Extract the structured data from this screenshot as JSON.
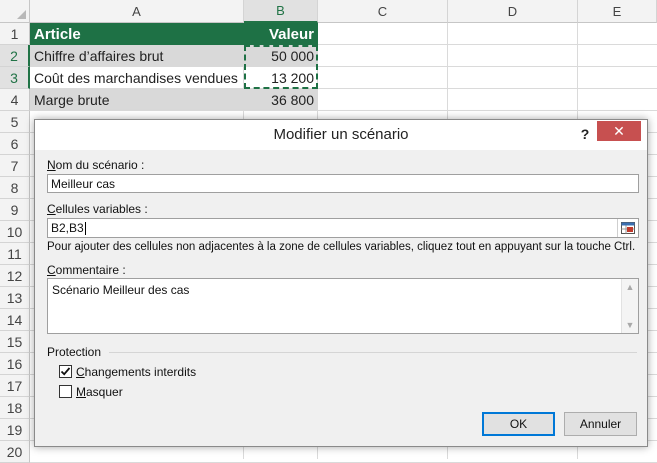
{
  "sheet": {
    "columns": [
      "A",
      "B",
      "C",
      "D",
      "E"
    ],
    "rows": [
      "1",
      "2",
      "3",
      "4",
      "5",
      "6",
      "7",
      "8",
      "9",
      "10",
      "11",
      "12",
      "13",
      "14",
      "15",
      "16",
      "17",
      "18",
      "19",
      "20"
    ],
    "table": {
      "header": {
        "article": "Article",
        "valeur": "Valeur"
      },
      "rows": [
        {
          "article": "Chiffre d’affaires brut",
          "valeur": "50 000"
        },
        {
          "article": "Coût des marchandises vendues",
          "valeur": "13 200"
        },
        {
          "article": "Marge brute",
          "valeur": "36 800"
        }
      ]
    },
    "colors": {
      "header_fill": "#1e7145",
      "gray_fill": "#d9d9d9",
      "selection": "#217346"
    }
  },
  "dialog": {
    "title": "Modifier un scénario",
    "help": "?",
    "close": "✕",
    "nom_label_key": "N",
    "nom_label_rest": "om du scénario :",
    "nom_value": "Meilleur cas",
    "cellules_label_key": "C",
    "cellules_label_rest": "ellules variables :",
    "cellules_value": "B2,B3",
    "hint": "Pour ajouter des cellules non adjacentes à la zone de cellules variables, cliquez tout en appuyant sur la touche Ctrl.",
    "commentaire_label_key": "C",
    "commentaire_label_rest": "ommentaire :",
    "commentaire_value": "Scénario Meilleur des cas",
    "protection_label": "Protection",
    "changements_key": "C",
    "changements_rest": "hangements interdits",
    "changements_checked": true,
    "masquer_key": "M",
    "masquer_rest": "asquer",
    "masquer_checked": false,
    "ok_label": "OK",
    "annuler_label": "Annuler",
    "close_color": "#c75050"
  }
}
